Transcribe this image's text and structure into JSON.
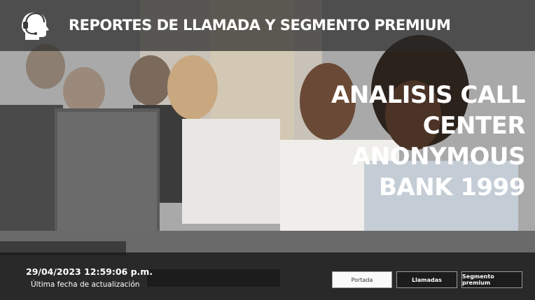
{
  "header": {
    "title": "REPORTES DE LLAMADA Y SEGMENTO PREMIUM",
    "logo_icon": "headset-agent-icon"
  },
  "hero": {
    "lines": [
      "ANALISIS CALL",
      "CENTER",
      "ANONYMOUS",
      "BANK 1999"
    ]
  },
  "update": {
    "datetime": "29/04/2023 12:59:06 p.m.",
    "label": "Última fecha de actualización"
  },
  "nav": {
    "portada": "Portada",
    "llamadas": "Llamadas",
    "segmento": "Segmento premium",
    "active": "Portada"
  },
  "colors": {
    "overlay_dark": "#282828",
    "text": "#ffffff",
    "button_active_bg": "#fafafa",
    "button_bg": "#1c1c1c"
  }
}
